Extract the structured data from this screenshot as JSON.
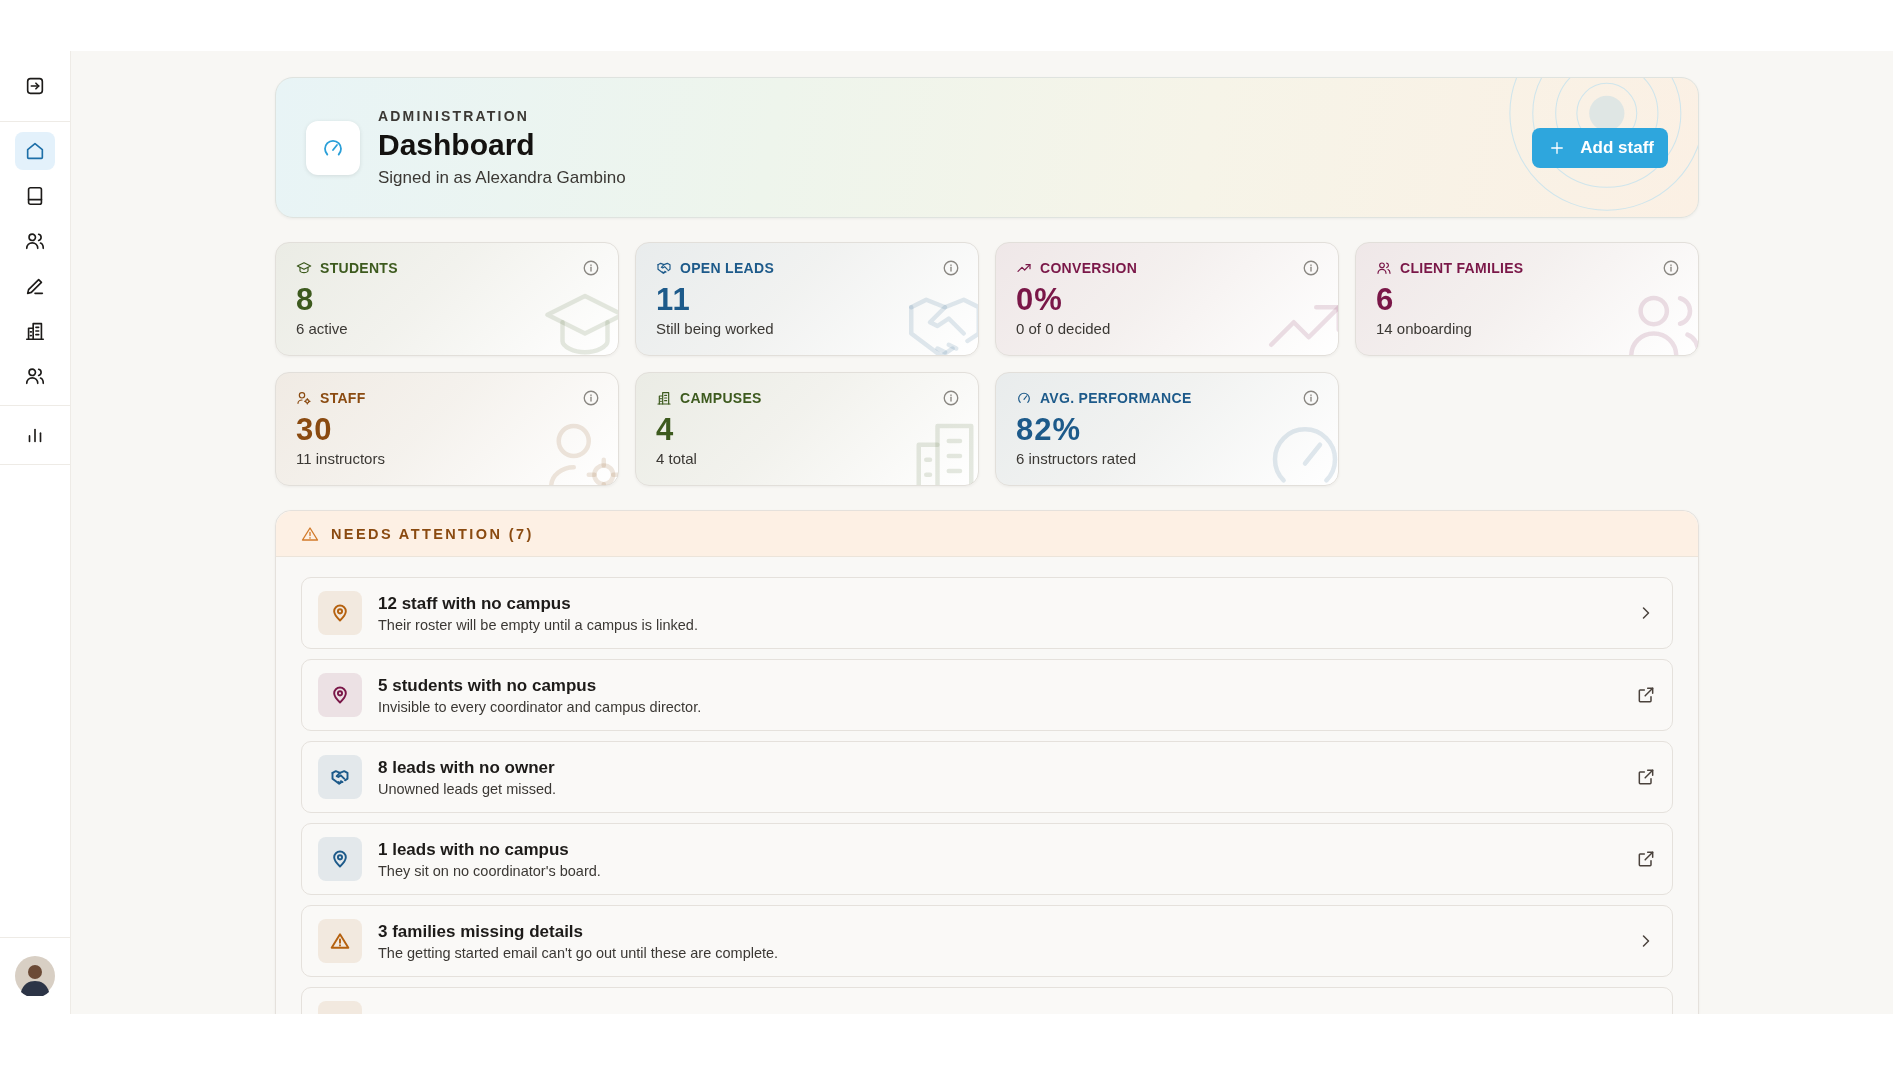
{
  "sidebar": {
    "groups": [
      {
        "items": [
          {
            "selected": true
          },
          {
            "selected": false
          },
          {
            "selected": false
          },
          {
            "selected": false
          },
          {
            "selected": false
          },
          {
            "selected": false
          }
        ]
      },
      {
        "items": [
          {
            "selected": false
          }
        ]
      }
    ]
  },
  "header": {
    "eyebrow": "ADMINISTRATION",
    "title": "Dashboard",
    "subtitle": "Signed in as Alexandra Gambino",
    "button": "Add staff"
  },
  "stats": [
    {
      "label": "STUDENTS",
      "value": "8",
      "note": "6 active",
      "color": "#3d5a1e"
    },
    {
      "label": "OPEN LEADS",
      "value": "11",
      "note": "Still being worked",
      "color": "#1d5a8a"
    },
    {
      "label": "CONVERSION",
      "value": "0%",
      "note": "0 of 0 decided",
      "color": "#7a1748"
    },
    {
      "label": "CLIENT FAMILIES",
      "value": "6",
      "note": "14 onboarding",
      "color": "#7a1748"
    },
    {
      "label": "STAFF",
      "value": "30",
      "note": "11 instructors",
      "color": "#8a4a10"
    },
    {
      "label": "CAMPUSES",
      "value": "4",
      "note": "4 total",
      "color": "#3d5a1e"
    },
    {
      "label": "AVG. PERFORMANCE",
      "value": "82%",
      "note": "6 instructors rated",
      "color": "#1d5a8a"
    }
  ],
  "attention": {
    "title": "NEEDS ATTENTION (7)",
    "items": [
      {
        "title": "12 staff with no campus",
        "description": "Their roster will be empty until a campus is linked.",
        "kind": "navigate",
        "color": "#b5610f"
      },
      {
        "title": "5 students with no campus",
        "description": "Invisible to every coordinator and campus director.",
        "kind": "external",
        "color": "#7a1748"
      },
      {
        "title": "8 leads with no owner",
        "description": "Unowned leads get missed.",
        "kind": "external",
        "color": "#1d5a8a"
      },
      {
        "title": "1 leads with no campus",
        "description": "They sit on no coordinator's board.",
        "kind": "external",
        "color": "#1d5a8a"
      },
      {
        "title": "3 families missing details",
        "description": "The getting started email can't go out until these are complete.",
        "kind": "navigate",
        "color": "#b5610f"
      }
    ]
  }
}
